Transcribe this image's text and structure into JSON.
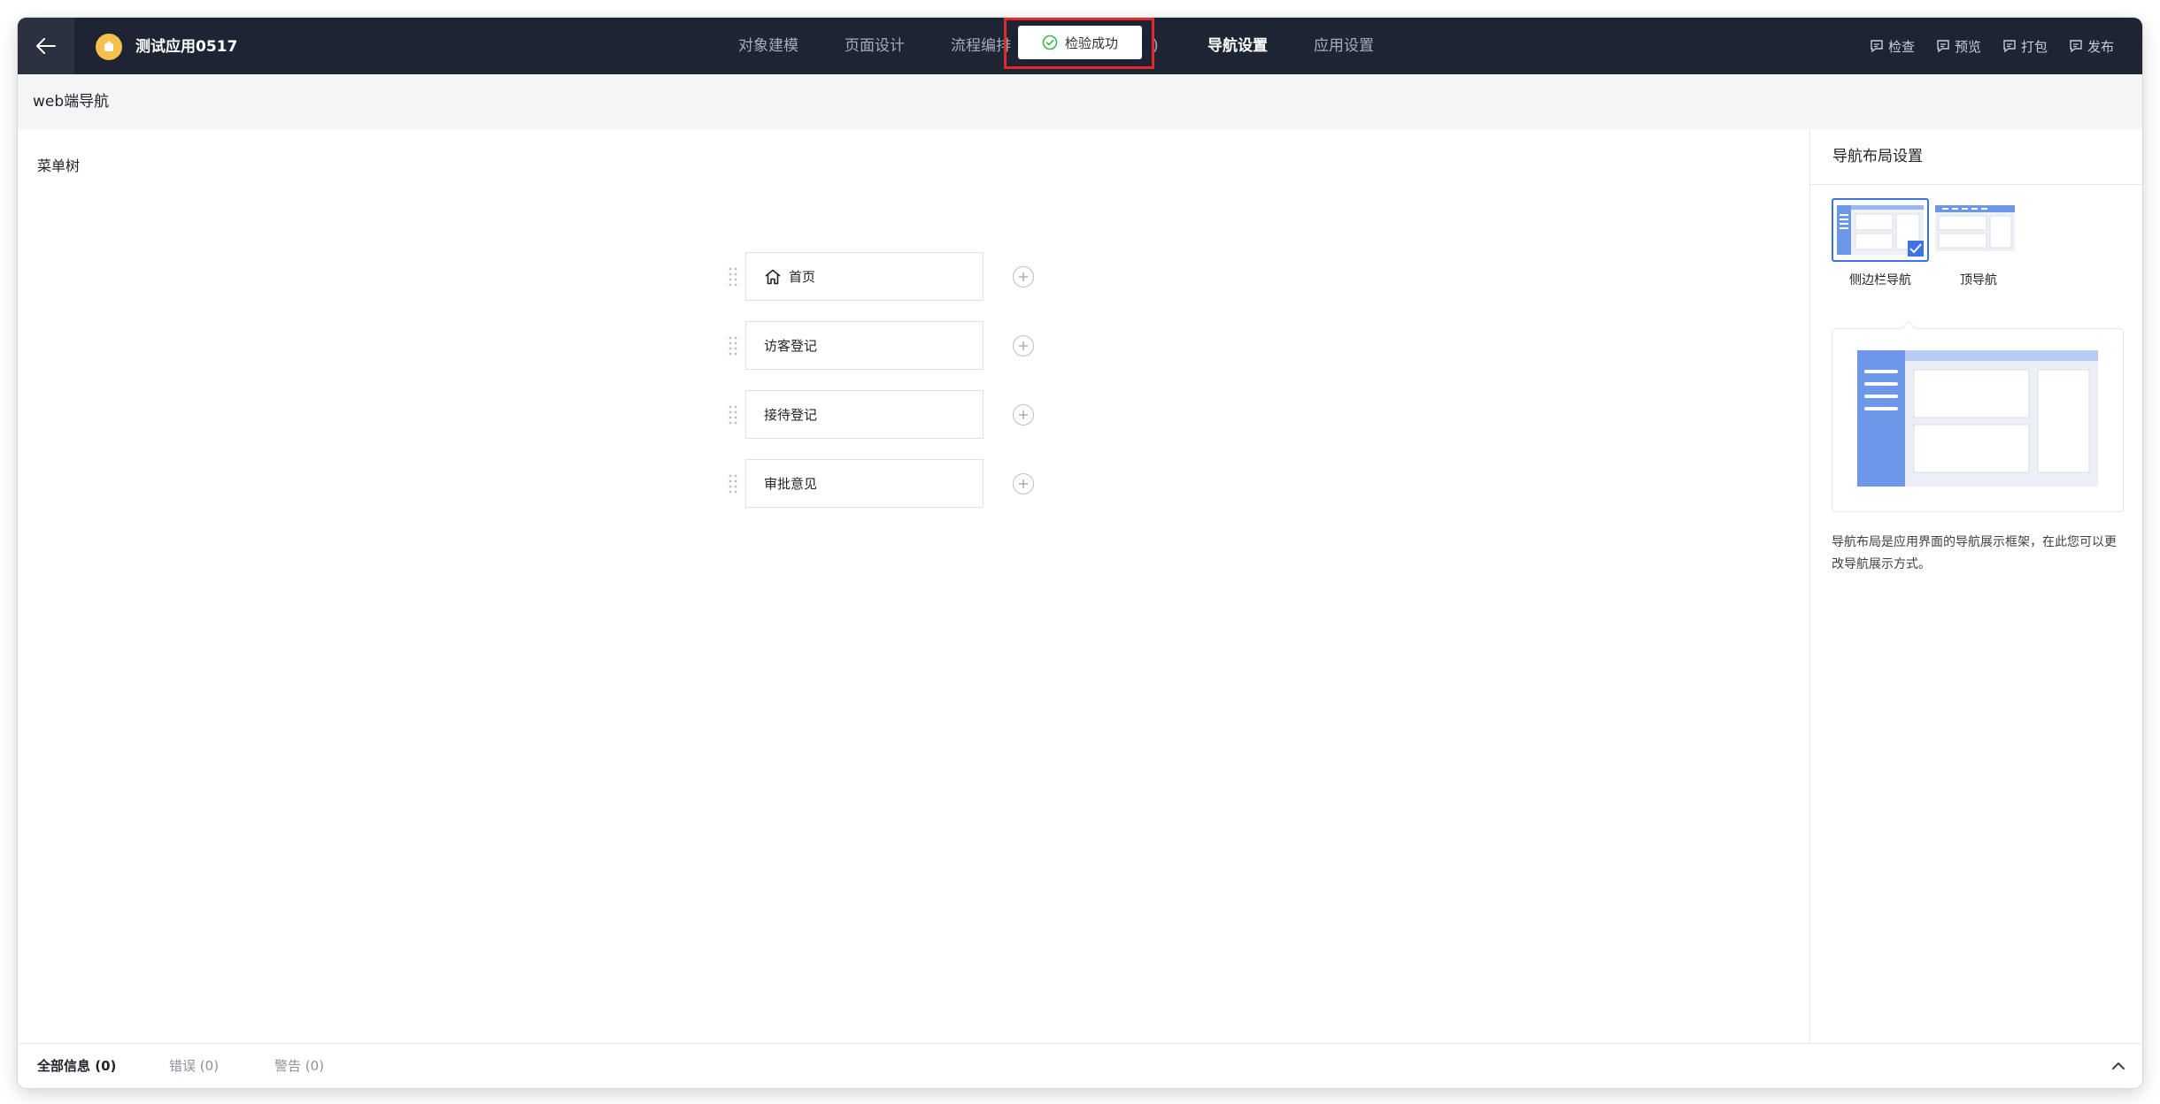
{
  "header": {
    "app_title": "测试应用0517",
    "tabs": [
      {
        "label": "对象建模"
      },
      {
        "label": "页面设计"
      },
      {
        "label": "流程编排"
      },
      {
        "label": "导航设置",
        "active": true
      },
      {
        "label": "应用设置"
      }
    ],
    "hidden_tab_fragment": ")",
    "actions": [
      {
        "label": "检查",
        "icon": "check-doc-icon"
      },
      {
        "label": "预览",
        "icon": "preview-doc-icon"
      },
      {
        "label": "打包",
        "icon": "package-doc-icon"
      },
      {
        "label": "发布",
        "icon": "publish-doc-icon"
      }
    ]
  },
  "toast": {
    "message": "检验成功",
    "icon": "check-circle-icon",
    "icon_color": "#3bb44a",
    "highlight_color": "#e02a2a"
  },
  "subheader": {
    "title": "web端导航"
  },
  "menu_tree": {
    "label": "菜单树",
    "items": [
      {
        "label": "首页",
        "icon": "home-icon"
      },
      {
        "label": "访客登记"
      },
      {
        "label": "接待登记"
      },
      {
        "label": "审批意见"
      }
    ]
  },
  "layout_panel": {
    "title": "导航布局设置",
    "options": [
      {
        "label": "侧边栏导航",
        "selected": true
      },
      {
        "label": "顶导航",
        "selected": false
      }
    ],
    "description": "导航布局是应用界面的导航展示框架，在此您可以更改导航展示方式。",
    "accent_color": "#6d97e8"
  },
  "footer": {
    "tabs": [
      {
        "label": "全部信息",
        "count": "(0)",
        "active": true
      },
      {
        "label": "错误",
        "count": "(0)"
      },
      {
        "label": "警告",
        "count": "(0)"
      }
    ]
  },
  "colors": {
    "topbar": "#1d2433",
    "accent": "#3d72e8"
  }
}
